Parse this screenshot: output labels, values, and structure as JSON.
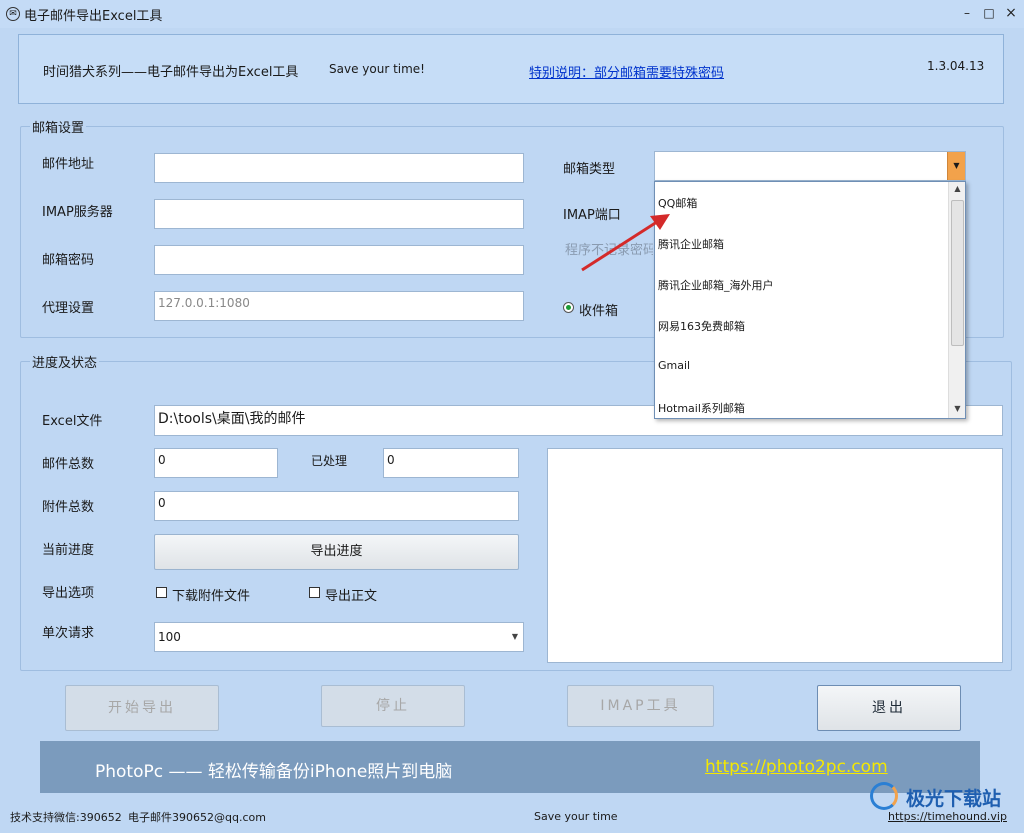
{
  "window": {
    "title": "电子邮件导出Excel工具",
    "icon": "mail-app-icon",
    "minimize_glyph": "–",
    "maximize_glyph": "□",
    "close_glyph": "×"
  },
  "header": {
    "series_title": "时间猎犬系列——电子邮件导出为Excel工具",
    "slogan": "Save your time!",
    "notice_link": "特别说明：部分邮箱需要特殊密码",
    "version": "1.3.04.13"
  },
  "mailbox_settings": {
    "legend": "邮箱设置",
    "email_label": "邮件地址",
    "email_value": "",
    "imap_server_label": "IMAP服务器",
    "imap_server_value": "",
    "password_label": "邮箱密码",
    "password_value": "",
    "proxy_label": "代理设置",
    "proxy_value": "127.0.0.1:1080",
    "mailbox_type_label": "邮箱类型",
    "mailbox_type_value": "",
    "imap_port_label": "IMAP端口",
    "hint_text": "程序不记录密码",
    "inbox_label": "收件箱",
    "dropdown_options": [
      "QQ邮箱",
      "腾讯企业邮箱",
      "腾讯企业邮箱_海外用户",
      "网易163免费邮箱",
      "Gmail",
      "Hotmail系列邮箱"
    ]
  },
  "progress": {
    "legend": "进度及状态",
    "excel_label": "Excel文件",
    "excel_value": "D:\\tools\\桌面\\我的邮件",
    "total_mail_label": "邮件总数",
    "total_mail_value": "0",
    "processed_label": "已处理",
    "processed_value": "0",
    "attachments_label": "附件总数",
    "attachments_value": "0",
    "current_progress_label": "当前进度",
    "progress_button": "导出进度",
    "export_options_label": "导出选项",
    "download_attachments_label": "下载附件文件",
    "export_body_label": "导出正文",
    "per_request_label": "单次请求",
    "per_request_value": "100"
  },
  "actions": {
    "start": "开始导出",
    "stop": "停止",
    "imap_tool": "IMAP工具",
    "exit": "退出"
  },
  "banner": {
    "text": "PhotoPc —— 轻松传输备份iPhone照片到电脑",
    "link": "https://photo2pc.com"
  },
  "statusbar": {
    "support_wechat": "技术支持微信:390652",
    "support_email": "电子邮件390652@qq.com",
    "slogan": "Save your time",
    "site": "https://timehound.vip",
    "watermark": "极光下载站"
  },
  "colors": {
    "background": "#bfd7f3",
    "accent_arrow": "#d42a2a",
    "link": "#0033cc",
    "banner_bg": "#7b9bbd",
    "banner_link": "#f5e800",
    "dropdown_button": "#f2a24b"
  }
}
